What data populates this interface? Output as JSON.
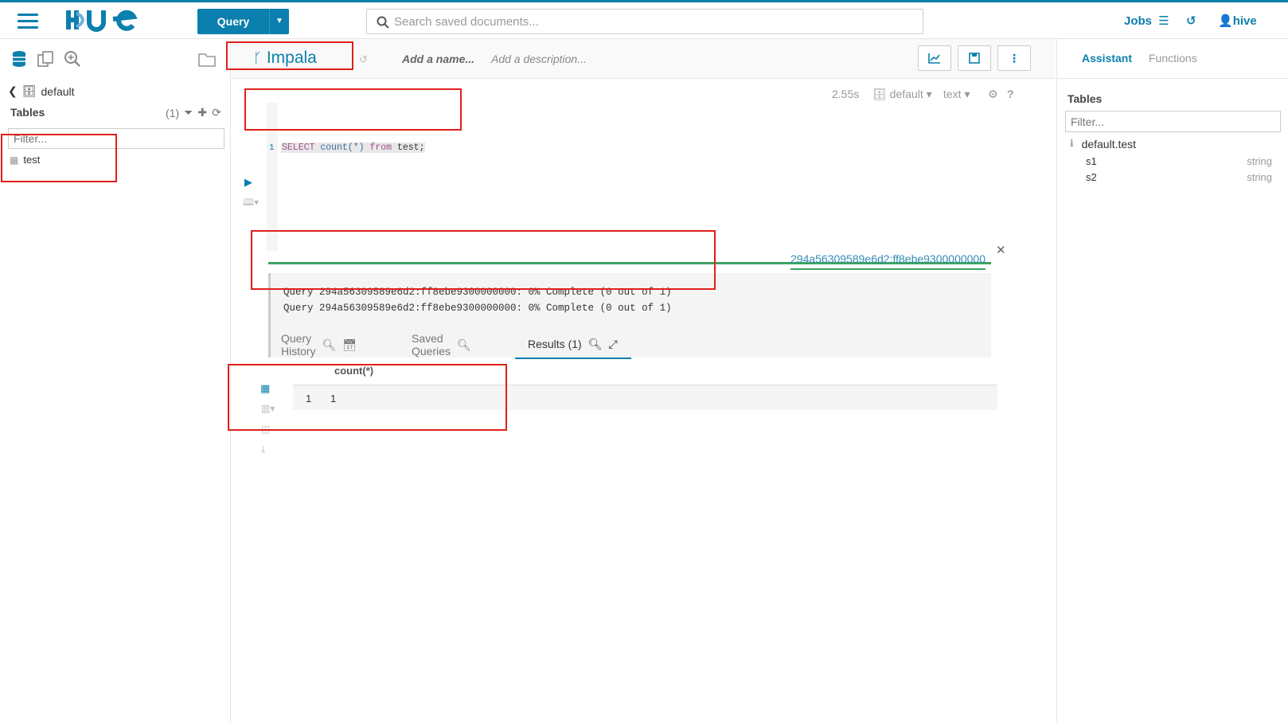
{
  "topbar": {
    "query_label": "Query",
    "search_placeholder": "Search saved documents...",
    "jobs_label": "Jobs",
    "user_label": "hive"
  },
  "left_panel": {
    "database": "default",
    "tables_header": "Tables",
    "tables_count": "(1)",
    "filter_placeholder": "Filter...",
    "tables": [
      "test"
    ]
  },
  "snippet": {
    "type": "Impala",
    "name_placeholder": "Add a name...",
    "description_placeholder": "Add a description...",
    "exec_time": "2.55s",
    "database": "default",
    "format": "text",
    "line_number": "1",
    "code_select": "SELECT",
    "code_count": "count(*)",
    "code_from": "from",
    "code_rest": "test;",
    "logs": [
      "Query 294a56309589e6d2:ff8ebe9300000000: 0% Complete (0 out of 1)",
      "Query 294a56309589e6d2:ff8ebe9300000000: 0% Complete (0 out of 1)"
    ],
    "job_id": "294a56309589e6d2:ff8ebe9300000000"
  },
  "result_tabs": {
    "history": "Query History",
    "saved": "Saved Queries",
    "results": "Results (1)"
  },
  "results": {
    "columns": [
      "count(*)"
    ],
    "rows": [
      [
        "1",
        "1"
      ]
    ]
  },
  "right_panel": {
    "tab_assistant": "Assistant",
    "tab_functions": "Functions",
    "tables_header": "Tables",
    "filter_placeholder": "Filter...",
    "table_name": "default.test",
    "columns": [
      {
        "name": "s1",
        "type": "string"
      },
      {
        "name": "s2",
        "type": "string"
      }
    ]
  },
  "colors": {
    "brand": "#0b7fad",
    "progress": "#3ea262",
    "annotation": "#e0201b"
  }
}
